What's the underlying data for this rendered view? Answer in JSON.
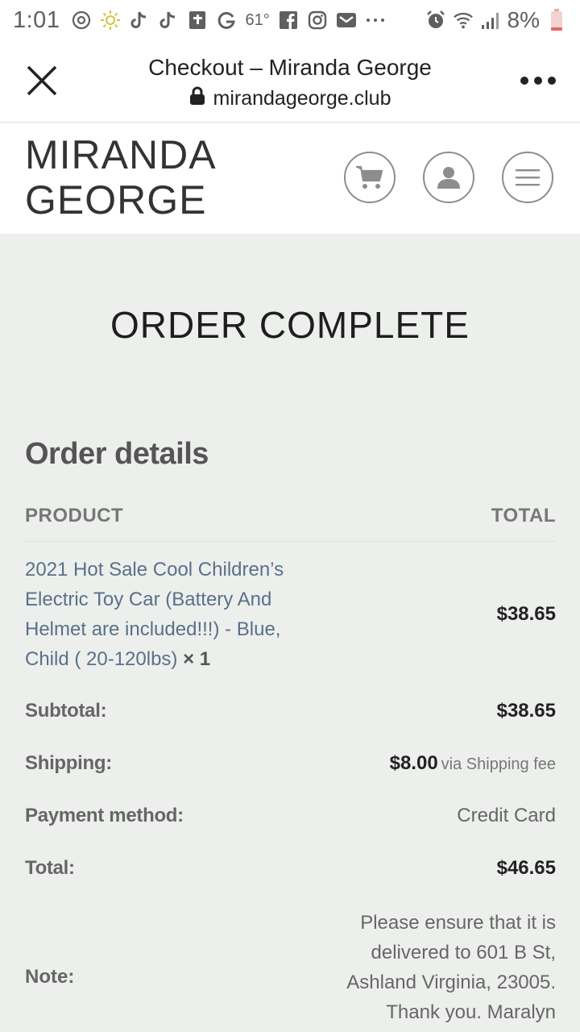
{
  "status_bar": {
    "time": "1:01",
    "temperature": "61°",
    "battery": "8%",
    "icons": [
      "signal-app-icon",
      "sun-icon",
      "tiktok-icon",
      "tiktok-icon",
      "bible-icon",
      "g-icon",
      "facebook-icon",
      "instagram-icon",
      "mail-icon",
      "more-icon",
      "alarm-icon",
      "wifi-icon",
      "cell-signal-icon",
      "battery-icon"
    ]
  },
  "browser": {
    "title": "Checkout – Miranda George",
    "url": "mirandageorge.club"
  },
  "site": {
    "brand_line1": "MIRANDA",
    "brand_line2": "GEORGE"
  },
  "page": {
    "heading": "ORDER COMPLETE",
    "details_title": "Order details",
    "col_product": "PRODUCT",
    "col_total": "TOTAL"
  },
  "order": {
    "product_name": "2021 Hot Sale Cool Children’s Electric Toy Car (Battery And Helmet are included!!!) - Blue, Child ( 20-120lbs)",
    "product_qty": "× 1",
    "product_total": "$38.65",
    "subtotal_label": "Subtotal:",
    "subtotal": "$38.65",
    "shipping_label": "Shipping:",
    "shipping": "$8.00",
    "shipping_via": "via Shipping fee",
    "payment_label": "Payment method:",
    "payment": "Credit Card",
    "total_label": "Total:",
    "total": "$46.65",
    "note_label": "Note:",
    "note": "Please ensure that it is delivered to 601 B St, Ashland Virginia, 23005. Thank you. Maralyn"
  },
  "colors": {
    "page_bg": "#edefed",
    "link": "#5a7089",
    "header_bg": "#ffffff"
  }
}
